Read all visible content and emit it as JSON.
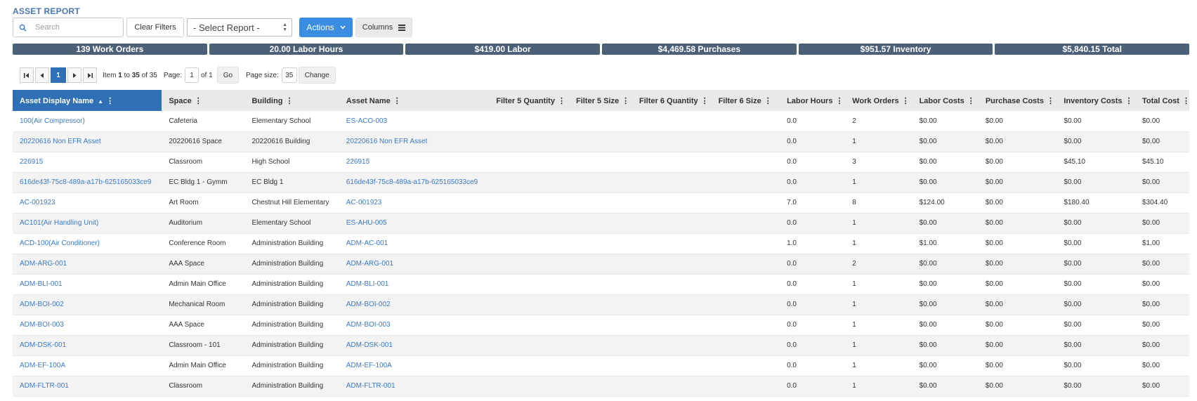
{
  "page": {
    "title": "ASSET REPORT"
  },
  "toolbar": {
    "search_placeholder": "Search",
    "clear_filters_label": "Clear Filters",
    "select_report_value": "- Select Report -",
    "actions_label": "Actions",
    "columns_label": "Columns"
  },
  "summary": [
    "139 Work Orders",
    "20.00 Labor Hours",
    "$419.00 Labor",
    "$4,469.58 Purchases",
    "$951.57 Inventory",
    "$5,840.15 Total"
  ],
  "pager": {
    "current_page": "1",
    "item_label": "Item",
    "range_start": "1",
    "to_label": "to",
    "range_end": "35",
    "of_label": "of",
    "total_items": "35",
    "page_label": "Page:",
    "page_input": "1",
    "page_of": "of 1",
    "go_label": "Go",
    "page_size_label": "Page size:",
    "page_size_value": "35",
    "change_label": "Change"
  },
  "columns": [
    "Asset Display Name",
    "Space",
    "Building",
    "Asset Name",
    "Filter 5 Quantity",
    "Filter 5 Size",
    "Filter 6 Quantity",
    "Filter 6 Size",
    "Labor Hours",
    "Work Orders",
    "Labor Costs",
    "Purchase Costs",
    "Inventory Costs",
    "Total Cost"
  ],
  "rows": [
    [
      "100(Air Compressor)",
      "Cafeteria",
      "Elementary School",
      "ES-ACO-003",
      "",
      "",
      "",
      "",
      "0.0",
      "2",
      "$0.00",
      "$0.00",
      "$0.00",
      "$0.00"
    ],
    [
      "20220616 Non EFR Asset",
      "20220616 Space",
      "20220616 Building",
      "20220616 Non EFR Asset",
      "",
      "",
      "",
      "",
      "0.0",
      "1",
      "$0.00",
      "$0.00",
      "$0.00",
      "$0.00"
    ],
    [
      "226915",
      "Classroom",
      "High School",
      "226915",
      "",
      "",
      "",
      "",
      "0.0",
      "3",
      "$0.00",
      "$0.00",
      "$45.10",
      "$45.10"
    ],
    [
      "616de43f-75c8-489a-a17b-625165033ce9",
      "EC Bldg 1 - Gymm",
      "EC Bldg 1",
      "616de43f-75c8-489a-a17b-625165033ce9",
      "",
      "",
      "",
      "",
      "0.0",
      "1",
      "$0.00",
      "$0.00",
      "$0.00",
      "$0.00"
    ],
    [
      "AC-001923",
      "Art Room",
      "Chestnut Hill Elementary",
      "AC-001923",
      "",
      "",
      "",
      "",
      "7.0",
      "8",
      "$124.00",
      "$0.00",
      "$180.40",
      "$304.40"
    ],
    [
      "AC101(Air Handling Unit)",
      "Auditorium",
      "Elementary School",
      "ES-AHU-005",
      "",
      "",
      "",
      "",
      "0.0",
      "1",
      "$0.00",
      "$0.00",
      "$0.00",
      "$0.00"
    ],
    [
      "ACD-100(Air Conditioner)",
      "Conference Room",
      "Administration Building",
      "ADM-AC-001",
      "",
      "",
      "",
      "",
      "1.0",
      "1",
      "$1.00",
      "$0.00",
      "$0.00",
      "$1.00"
    ],
    [
      "ADM-ARG-001",
      "AAA Space",
      "Administration Building",
      "ADM-ARG-001",
      "",
      "",
      "",
      "",
      "0.0",
      "2",
      "$0.00",
      "$0.00",
      "$0.00",
      "$0.00"
    ],
    [
      "ADM-BLI-001",
      "Admin Main Office",
      "Administration Building",
      "ADM-BLI-001",
      "",
      "",
      "",
      "",
      "0.0",
      "1",
      "$0.00",
      "$0.00",
      "$0.00",
      "$0.00"
    ],
    [
      "ADM-BOI-002",
      "Mechanical Room",
      "Administration Building",
      "ADM-BOI-002",
      "",
      "",
      "",
      "",
      "0.0",
      "1",
      "$0.00",
      "$0.00",
      "$0.00",
      "$0.00"
    ],
    [
      "ADM-BOI-003",
      "AAA Space",
      "Administration Building",
      "ADM-BOI-003",
      "",
      "",
      "",
      "",
      "0.0",
      "1",
      "$0.00",
      "$0.00",
      "$0.00",
      "$0.00"
    ],
    [
      "ADM-DSK-001",
      "Classroom - 101",
      "Administration Building",
      "ADM-DSK-001",
      "",
      "",
      "",
      "",
      "0.0",
      "1",
      "$0.00",
      "$0.00",
      "$0.00",
      "$0.00"
    ],
    [
      "ADM-EF-100A",
      "Admin Main Office",
      "Administration Building",
      "ADM-EF-100A",
      "",
      "",
      "",
      "",
      "0.0",
      "1",
      "$0.00",
      "$0.00",
      "$0.00",
      "$0.00"
    ],
    [
      "ADM-FLTR-001",
      "Classroom",
      "Administration Building",
      "ADM-FLTR-001",
      "",
      "",
      "",
      "",
      "0.0",
      "1",
      "$0.00",
      "$0.00",
      "$0.00",
      "$0.00"
    ]
  ]
}
